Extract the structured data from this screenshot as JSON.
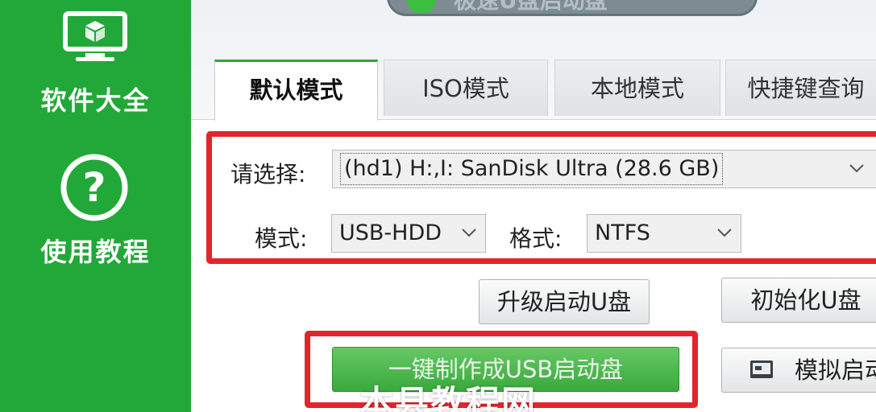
{
  "sidebar": {
    "items": [
      {
        "label": "软件大全",
        "icon": "monitor-box-icon"
      },
      {
        "label": "使用教程",
        "icon": "question-circle-icon"
      }
    ]
  },
  "banner": {
    "text": "极速U盘启动盘"
  },
  "tabs": [
    {
      "label": "默认模式",
      "active": true
    },
    {
      "label": "ISO模式",
      "active": false
    },
    {
      "label": "本地模式",
      "active": false
    },
    {
      "label": "快捷键查询",
      "active": false
    }
  ],
  "form": {
    "select_label": "请选择:",
    "drive_value": "(hd1) H:,I: SanDisk Ultra (28.6 GB)",
    "mode_label": "模式:",
    "mode_value": "USB-HDD",
    "format_label": "格式:",
    "format_value": "NTFS"
  },
  "buttons": {
    "upgrade": "升级启动U盘",
    "init": "初始化U盘",
    "make": "一键制作成USB启动盘",
    "simulate": "模拟启动"
  },
  "watermark": "本县教程网",
  "colors": {
    "sidebar_green": "#22a838",
    "make_button_green": "#3aa93c",
    "highlight_red": "#e2252c",
    "active_tab_accent": "#2da83b"
  }
}
